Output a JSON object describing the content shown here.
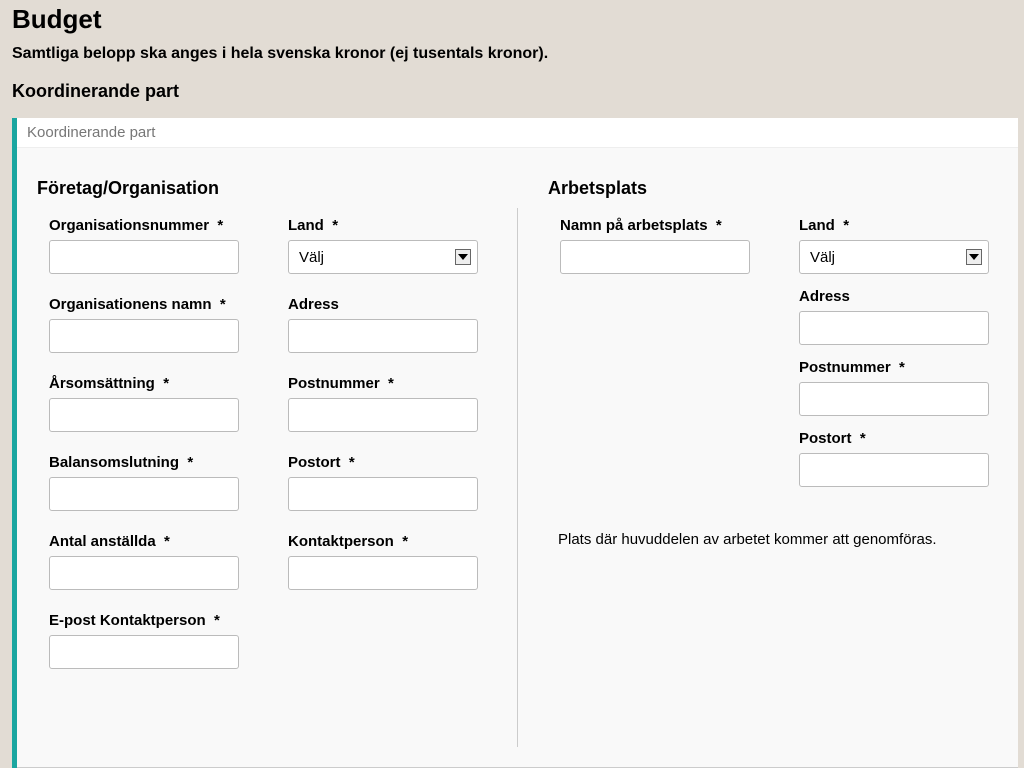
{
  "header": {
    "title": "Budget",
    "subtitle": "Samtliga belopp ska anges i hela svenska kronor (ej tusentals kronor).",
    "section_heading": "Koordinerande part"
  },
  "panel": {
    "header": "Koordinerande part"
  },
  "org": {
    "group_title": "Företag/Organisation",
    "orgnr_label": "Organisationsnummer",
    "orgname_label": "Organisationens namn",
    "turnover_label": "Årsomsättning",
    "balance_label": "Balansomslutning",
    "employees_label": "Antal anställda",
    "contact_email_label": "E-post Kontaktperson",
    "country_label": "Land",
    "country_value": "Välj",
    "address_label": "Adress",
    "postcode_label": "Postnummer",
    "city_label": "Postort",
    "contact_label": "Kontaktperson"
  },
  "workplace": {
    "group_title": "Arbetsplats",
    "name_label": "Namn på arbetsplats",
    "country_label": "Land",
    "country_value": "Välj",
    "address_label": "Adress",
    "postcode_label": "Postnummer",
    "city_label": "Postort",
    "note": "Plats där huvuddelen av arbetet kommer att genomföras."
  },
  "asterisk": "*"
}
